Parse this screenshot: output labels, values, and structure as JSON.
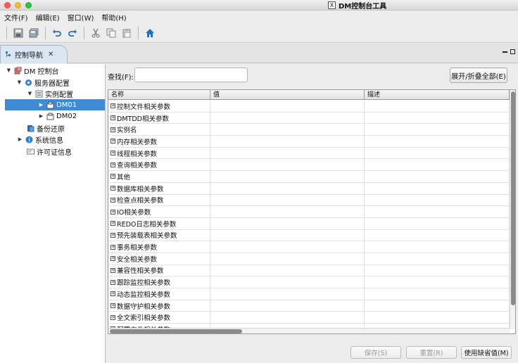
{
  "window": {
    "title": "DM控制台工具",
    "title_icon_glyph": "X"
  },
  "menu": [
    "文件(F)",
    "编辑(E)",
    "窗口(W)",
    "帮助(H)"
  ],
  "toolbar": {
    "icons": [
      "save-icon",
      "save-all-icon",
      "undo-icon",
      "redo-icon",
      "cut-icon",
      "copy-icon",
      "paste-icon",
      "home-icon"
    ],
    "accent_color": "#1e6fc9"
  },
  "view_tab": {
    "label": "控制导航",
    "close_glyph": "✕"
  },
  "tree": {
    "root": "DM 控制台",
    "server_config": "服务器配置",
    "instance_config": "实例配置",
    "instances": [
      "DM01",
      "DM02"
    ],
    "backup": "备份还原",
    "system_info": "系统信息",
    "license": "许可证信息",
    "selection_color": "#3f8bd6"
  },
  "search": {
    "label": "查找(F):",
    "value": ""
  },
  "expand_button": "展开/折叠全部(E)",
  "table": {
    "columns": [
      "名称",
      "值",
      "描述"
    ],
    "rows": [
      "控制文件相关参数",
      "DMTDD相关参数",
      "实例名",
      "内存相关参数",
      "线程相关参数",
      "查询相关参数",
      "其他",
      "数据库相关参数",
      "检查点相关参数",
      "IO相关参数",
      "REDO日志相关参数",
      "预先装载表相关参数",
      "事务相关参数",
      "安全相关参数",
      "兼容性相关参数",
      "跟踪监控相关参数",
      "动态监控相关参数",
      "数据守护相关参数",
      "全文索引相关参数",
      "配置文件相关参数"
    ]
  },
  "buttons": {
    "save": "保存(S)",
    "reset": "重置(R)",
    "default": "使用缺省值(M)"
  }
}
